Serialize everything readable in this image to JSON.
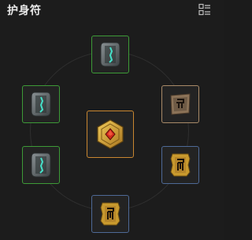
{
  "header": {
    "title": "护身符",
    "menu_icon": "list-view-icon"
  },
  "colors": {
    "frame_green": "#3d9a37",
    "frame_orange": "#c88630",
    "frame_tan": "#a88a68",
    "frame_blue": "#4e6996"
  },
  "slots": [
    {
      "id": "top",
      "item_icon": "teal-rune-stone-icon",
      "frame": "green"
    },
    {
      "id": "upper-left",
      "item_icon": "teal-rune-stone-icon",
      "frame": "green"
    },
    {
      "id": "lower-left",
      "item_icon": "teal-rune-stone-icon",
      "frame": "green"
    },
    {
      "id": "upper-right",
      "item_icon": "bronze-glyph-talisman-icon",
      "frame": "tan"
    },
    {
      "id": "lower-right",
      "item_icon": "gold-glyph-talisman-icon",
      "frame": "blue"
    },
    {
      "id": "bottom",
      "item_icon": "gold-glyph-talisman-icon",
      "frame": "blue"
    },
    {
      "id": "center",
      "item_icon": "gold-hexagon-red-gem-amulet-icon",
      "frame": "orange"
    }
  ]
}
